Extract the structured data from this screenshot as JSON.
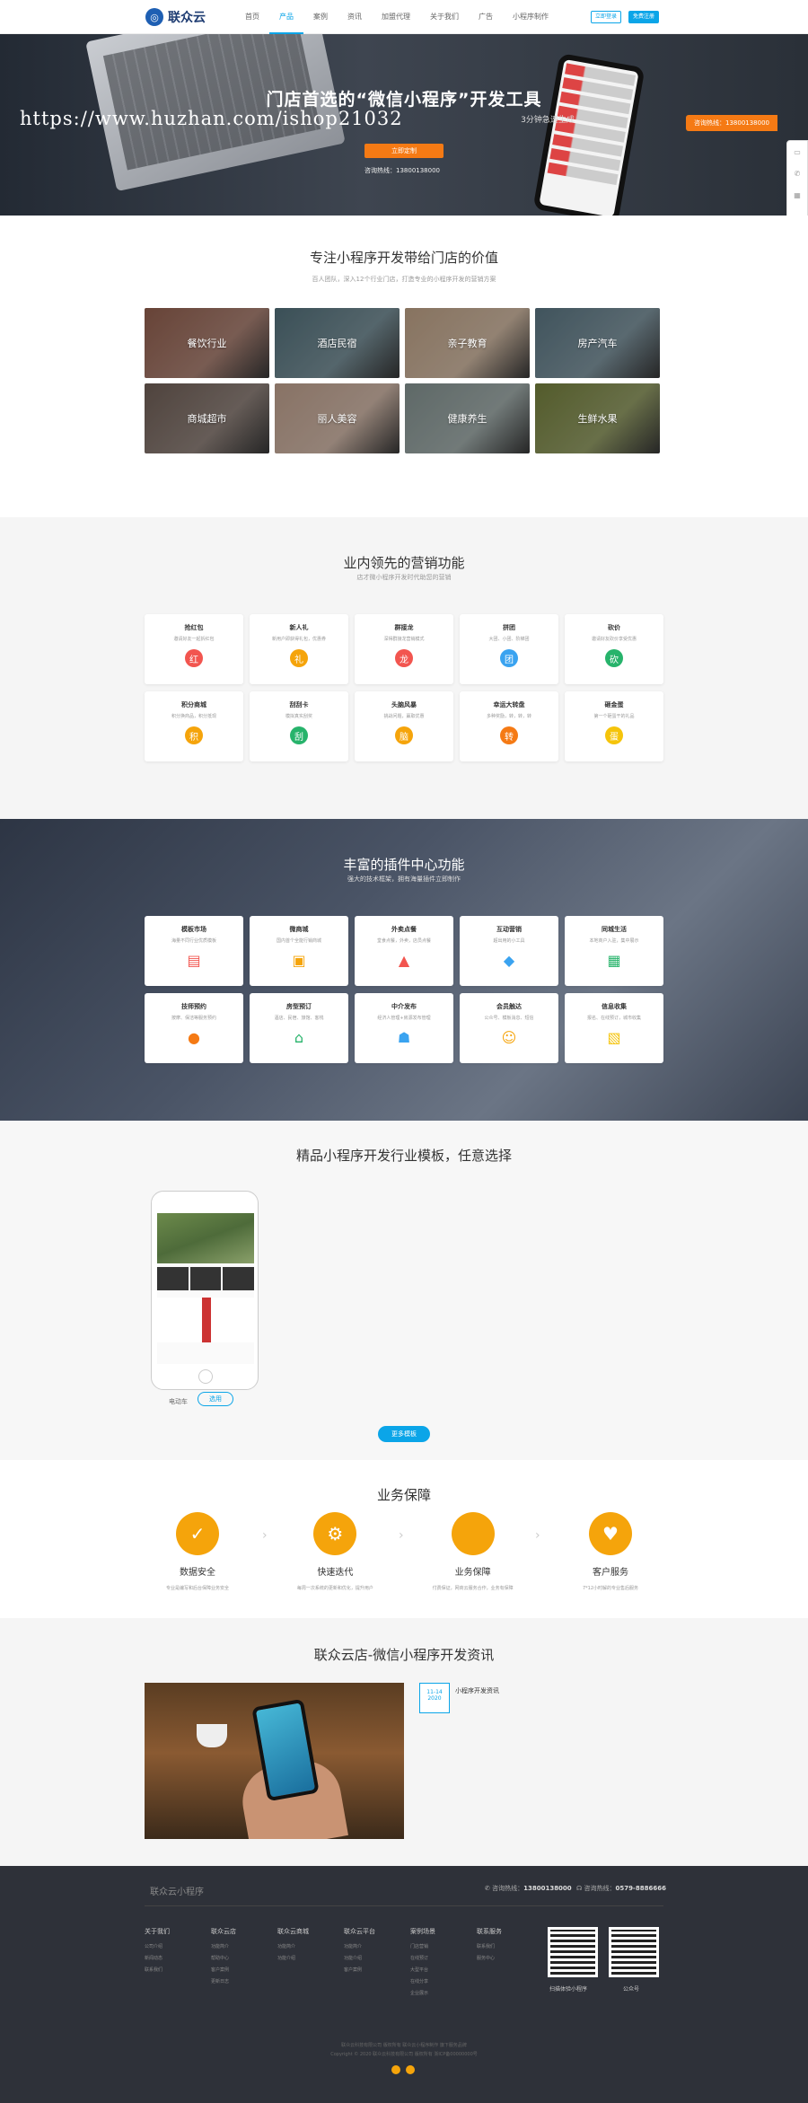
{
  "header": {
    "logo_text": "联众云",
    "nav": [
      "首页",
      "产品",
      "案例",
      "资讯",
      "加盟代理",
      "关于我们",
      "广告",
      "小程序制作"
    ],
    "active_index": 1,
    "login": "立即登录",
    "register": "免费注册"
  },
  "hero": {
    "title": "门店首选的“微信小程序”开发工具",
    "subtitle": "3分钟急速生成",
    "button": "立即定制",
    "tel": "咨询热线：13800138000",
    "watermark": "https://www.huzhan.com/ishop21032",
    "hotline_tab": "咨询热线：13800138000"
  },
  "value": {
    "title": "专注小程序开发带给门店的价值",
    "subtitle": "百人团队，深入12个行业门店，打造专业的小程序开发的营销方案",
    "tiles": [
      {
        "label": "餐饮行业",
        "color": "#8a5a4a"
      },
      {
        "label": "酒店民宿",
        "color": "#4e6a74"
      },
      {
        "label": "亲子教育",
        "color": "#b59a80"
      },
      {
        "label": "房产汽车",
        "color": "#56707c"
      },
      {
        "label": "商城超市",
        "color": "#6a5a52"
      },
      {
        "label": "丽人美容",
        "color": "#b69987"
      },
      {
        "label": "健康养生",
        "color": "#7e8c8a"
      },
      {
        "label": "生鲜水果",
        "color": "#6f7a3a"
      }
    ]
  },
  "marketing": {
    "title": "业内领先的营销功能",
    "subtitle": "店才微小程序开发时代助您的营销",
    "cards": [
      {
        "t": "抢红包",
        "d": "邀请好友一起拆红包",
        "icon": "红",
        "color": "#f2554f"
      },
      {
        "t": "新人礼",
        "d": "新用户即获得礼包，优惠券",
        "icon": "礼",
        "color": "#f5a40b"
      },
      {
        "t": "群接龙",
        "d": "深得群接龙营销模式",
        "icon": "龙",
        "color": "#f2554f"
      },
      {
        "t": "拼团",
        "d": "大团、小团、阶梯团",
        "icon": "团",
        "color": "#3aa3f0"
      },
      {
        "t": "砍价",
        "d": "邀请好友砍价享受优惠",
        "icon": "砍",
        "color": "#27b36b"
      },
      {
        "t": "积分商城",
        "d": "积分换商品，积分抵现",
        "icon": "积",
        "color": "#f5a40b"
      },
      {
        "t": "刮刮卡",
        "d": "模拟真实刮奖",
        "icon": "刮",
        "color": "#27b36b"
      },
      {
        "t": "头脑风暴",
        "d": "挑战问题，赢取优惠",
        "icon": "脑",
        "color": "#f5a40b"
      },
      {
        "t": "幸运大转盘",
        "d": "多种奖励，转，转，转",
        "icon": "转",
        "color": "#f57a14"
      },
      {
        "t": "砸金蛋",
        "d": "第一个砸蛋干的礼品",
        "icon": "蛋",
        "color": "#f5c40b"
      }
    ]
  },
  "plugins": {
    "title": "丰富的插件中心功能",
    "subtitle": "强大的技术框架，拥有海量插件立即制作",
    "cards": [
      {
        "t": "模板市场",
        "d": "海量不同行业优质模板",
        "icon": "▤",
        "color": "#f2554f"
      },
      {
        "t": "微商城",
        "d": "国内首个全能行销商城",
        "icon": "▣",
        "color": "#f5a40b"
      },
      {
        "t": "外卖点餐",
        "d": "堂食点餐，外卖，店员点餐",
        "icon": "▲",
        "color": "#f2554f"
      },
      {
        "t": "互动营销",
        "d": "超出用的小工具",
        "icon": "◆",
        "color": "#3aa3f0"
      },
      {
        "t": "同城生活",
        "d": "本地商户入驻，集中展示",
        "icon": "▦",
        "color": "#27b36b"
      },
      {
        "t": "技师预约",
        "d": "按摩、保洁等服务预约",
        "icon": "●",
        "color": "#f57a14"
      },
      {
        "t": "房型预订",
        "d": "酒店、民宿、旅馆、客栈",
        "icon": "⌂",
        "color": "#27b36b"
      },
      {
        "t": "中介发布",
        "d": "经济人管理+房源发布管理",
        "icon": "☗",
        "color": "#3aa3f0"
      },
      {
        "t": "会员触达",
        "d": "公众号、模板消息、短信",
        "icon": "☺",
        "color": "#f5a40b"
      },
      {
        "t": "信息收集",
        "d": "报名、在线预订，城市收集",
        "icon": "▧",
        "color": "#f5c40b"
      }
    ]
  },
  "templates": {
    "title": "精品小程序开发行业模板，任意选择",
    "item_name": "电动车",
    "select": "选用",
    "more": "更多模板"
  },
  "guarantee": {
    "title": "业务保障",
    "items": [
      {
        "t": "数据安全",
        "d": "专业是编写和后台保障业务安全",
        "icon": "✓"
      },
      {
        "t": "快速迭代",
        "d": "每周一次系统的更新和优化，提升用户",
        "icon": "⚙"
      },
      {
        "t": "业务保障",
        "d": "付费保证，网商云服务合作，业务有保障",
        "icon": ""
      },
      {
        "t": "客户服务",
        "d": "7*12小时解的专业售后服务",
        "icon": "♥"
      }
    ]
  },
  "news": {
    "title": "联众云店-微信小程序开发资讯",
    "date_md": "11-14",
    "date_y": "2020",
    "item": "小程序开发资讯"
  },
  "footer": {
    "brand": "联众云小程序",
    "phone_label": "咨询热线：",
    "phone": "13800138000",
    "tel_label": "咨询热线：",
    "tel": "0579-8886666",
    "cols": [
      {
        "h": "关于我们",
        "l": [
          "公司介绍",
          "新闻动态",
          "联系我们"
        ]
      },
      {
        "h": "联众云店",
        "l": [
          "功能简介",
          "帮助中心",
          "客户案例",
          "更新日志"
        ]
      },
      {
        "h": "联众云商城",
        "l": [
          "功能简介",
          "功能介绍"
        ]
      },
      {
        "h": "联众云平台",
        "l": [
          "功能简介",
          "功能介绍",
          "客户案例"
        ]
      },
      {
        "h": "案例场景",
        "l": [
          "门店营销",
          "在线预订",
          "大型平台",
          "在线分享",
          "企业展示"
        ]
      },
      {
        "h": "联系服务",
        "l": [
          "联系我们",
          "服务中心"
        ]
      }
    ],
    "qr1": "扫描体验小程序",
    "qr2": "公众号",
    "copy1": "联众云科技有限公司 版权所有 联众云小程序制作 旗下服务品牌",
    "copy2": "Copyright © 2020 联众云科技有限公司 版权所有 浙ICP备00000000号"
  }
}
